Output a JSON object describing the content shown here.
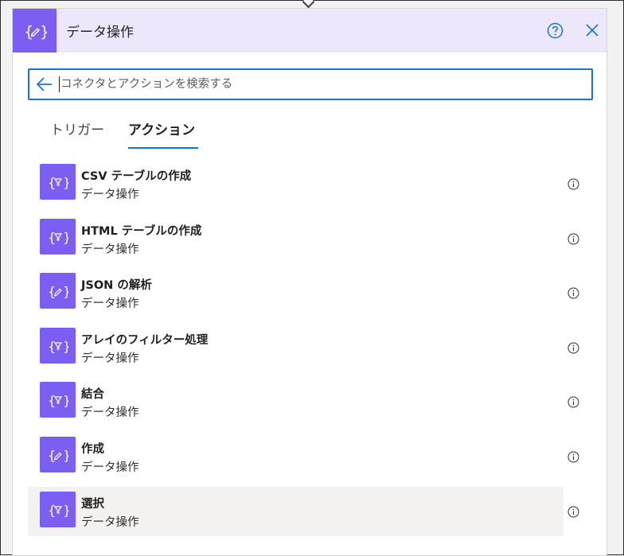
{
  "header": {
    "title": "データ操作",
    "icon": "curly-braces-pencil-icon",
    "accent_color": "#7b5ff3",
    "background_color": "#ede7fb"
  },
  "search": {
    "placeholder": "コネクタとアクションを検索する",
    "value": ""
  },
  "tabs": [
    {
      "label": "トリガー",
      "active": false
    },
    {
      "label": "アクション",
      "active": true
    }
  ],
  "actions": [
    {
      "title": "CSV テーブルの作成",
      "subtitle": "データ操作",
      "icon": "curly-braces-filter-icon"
    },
    {
      "title": "HTML テーブルの作成",
      "subtitle": "データ操作",
      "icon": "curly-braces-filter-icon"
    },
    {
      "title": "JSON の解析",
      "subtitle": "データ操作",
      "icon": "curly-braces-pencil-icon"
    },
    {
      "title": "アレイのフィルター処理",
      "subtitle": "データ操作",
      "icon": "curly-braces-filter-icon"
    },
    {
      "title": "結合",
      "subtitle": "データ操作",
      "icon": "curly-braces-filter-icon"
    },
    {
      "title": "作成",
      "subtitle": "データ操作",
      "icon": "curly-braces-pencil-icon"
    },
    {
      "title": "選択",
      "subtitle": "データ操作",
      "icon": "curly-braces-filter-icon",
      "selected": true
    }
  ]
}
